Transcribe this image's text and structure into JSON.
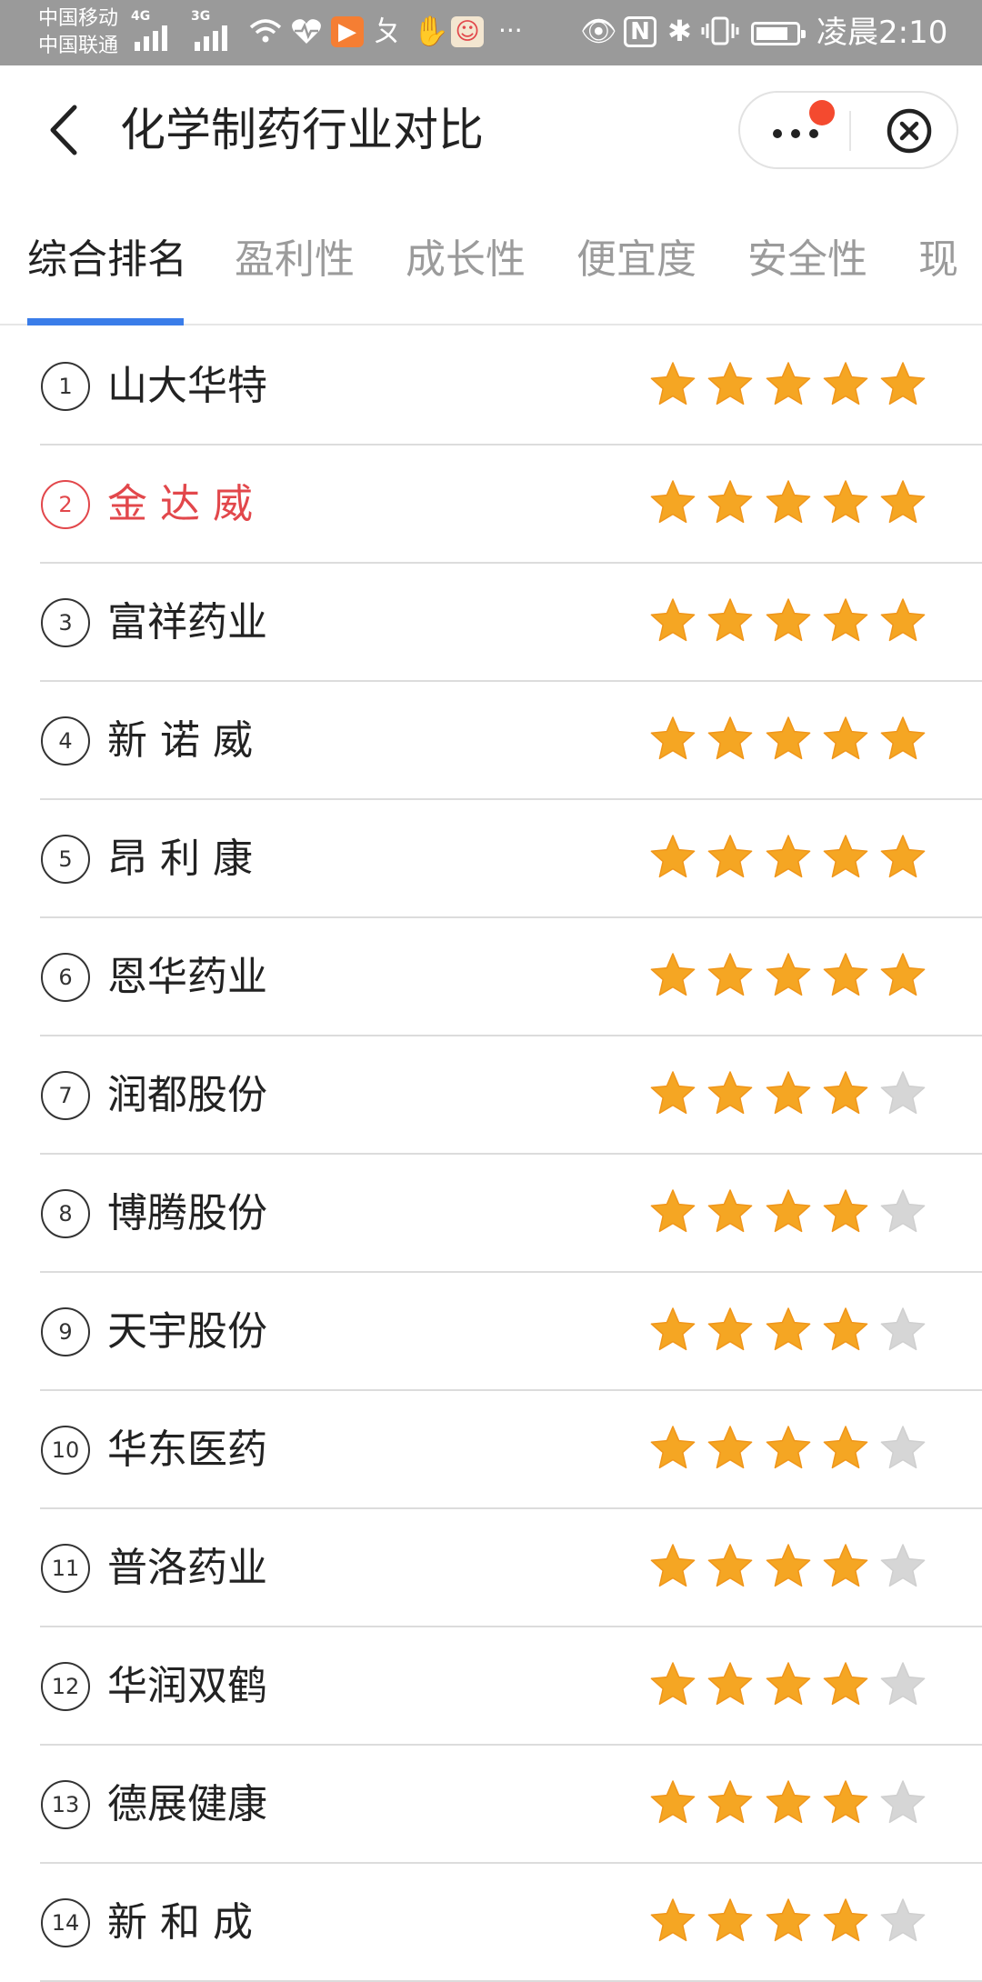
{
  "status_bar": {
    "carrier_1": "中国移动",
    "carrier_2": "中国联通",
    "signal_1_label": "4G",
    "signal_2_label": "3G",
    "time": "凌晨2:10",
    "icons": [
      "signal-icon",
      "signal-icon",
      "wifi-icon",
      "heart-icon",
      "video-app-icon",
      "app-icon",
      "hand-icon",
      "app-avatar-icon",
      "more-icon",
      "eye-icon",
      "nfc-icon",
      "bluetooth-icon",
      "vibrate-icon",
      "battery-icon"
    ]
  },
  "header": {
    "title": "化学制药行业对比",
    "more_badge_color": "#f44a2f"
  },
  "tabs": [
    "综合排名",
    "盈利性",
    "成长性",
    "便宜度",
    "安全性",
    "现"
  ],
  "active_tab": 0,
  "colors": {
    "accent": "#3a7de9",
    "highlight": "#e2474b",
    "star_on": "#f5a623",
    "star_off": "#d6d6d6"
  },
  "rankings": [
    {
      "rank": "1",
      "name": "山大华特",
      "stars": 5
    },
    {
      "rank": "2",
      "name": "金 达 威",
      "stars": 5,
      "highlighted": true
    },
    {
      "rank": "3",
      "name": "富祥药业",
      "stars": 5
    },
    {
      "rank": "4",
      "name": "新 诺 威",
      "stars": 5
    },
    {
      "rank": "5",
      "name": "昂 利 康",
      "stars": 5
    },
    {
      "rank": "6",
      "name": "恩华药业",
      "stars": 5
    },
    {
      "rank": "7",
      "name": "润都股份",
      "stars": 4
    },
    {
      "rank": "8",
      "name": "博腾股份",
      "stars": 4
    },
    {
      "rank": "9",
      "name": "天宇股份",
      "stars": 4
    },
    {
      "rank": "10",
      "name": "华东医药",
      "stars": 4
    },
    {
      "rank": "11",
      "name": "普洛药业",
      "stars": 4
    },
    {
      "rank": "12",
      "name": "华润双鹤",
      "stars": 4
    },
    {
      "rank": "13",
      "name": "德展健康",
      "stars": 4
    },
    {
      "rank": "14",
      "name": "新 和 成",
      "stars": 4
    }
  ]
}
